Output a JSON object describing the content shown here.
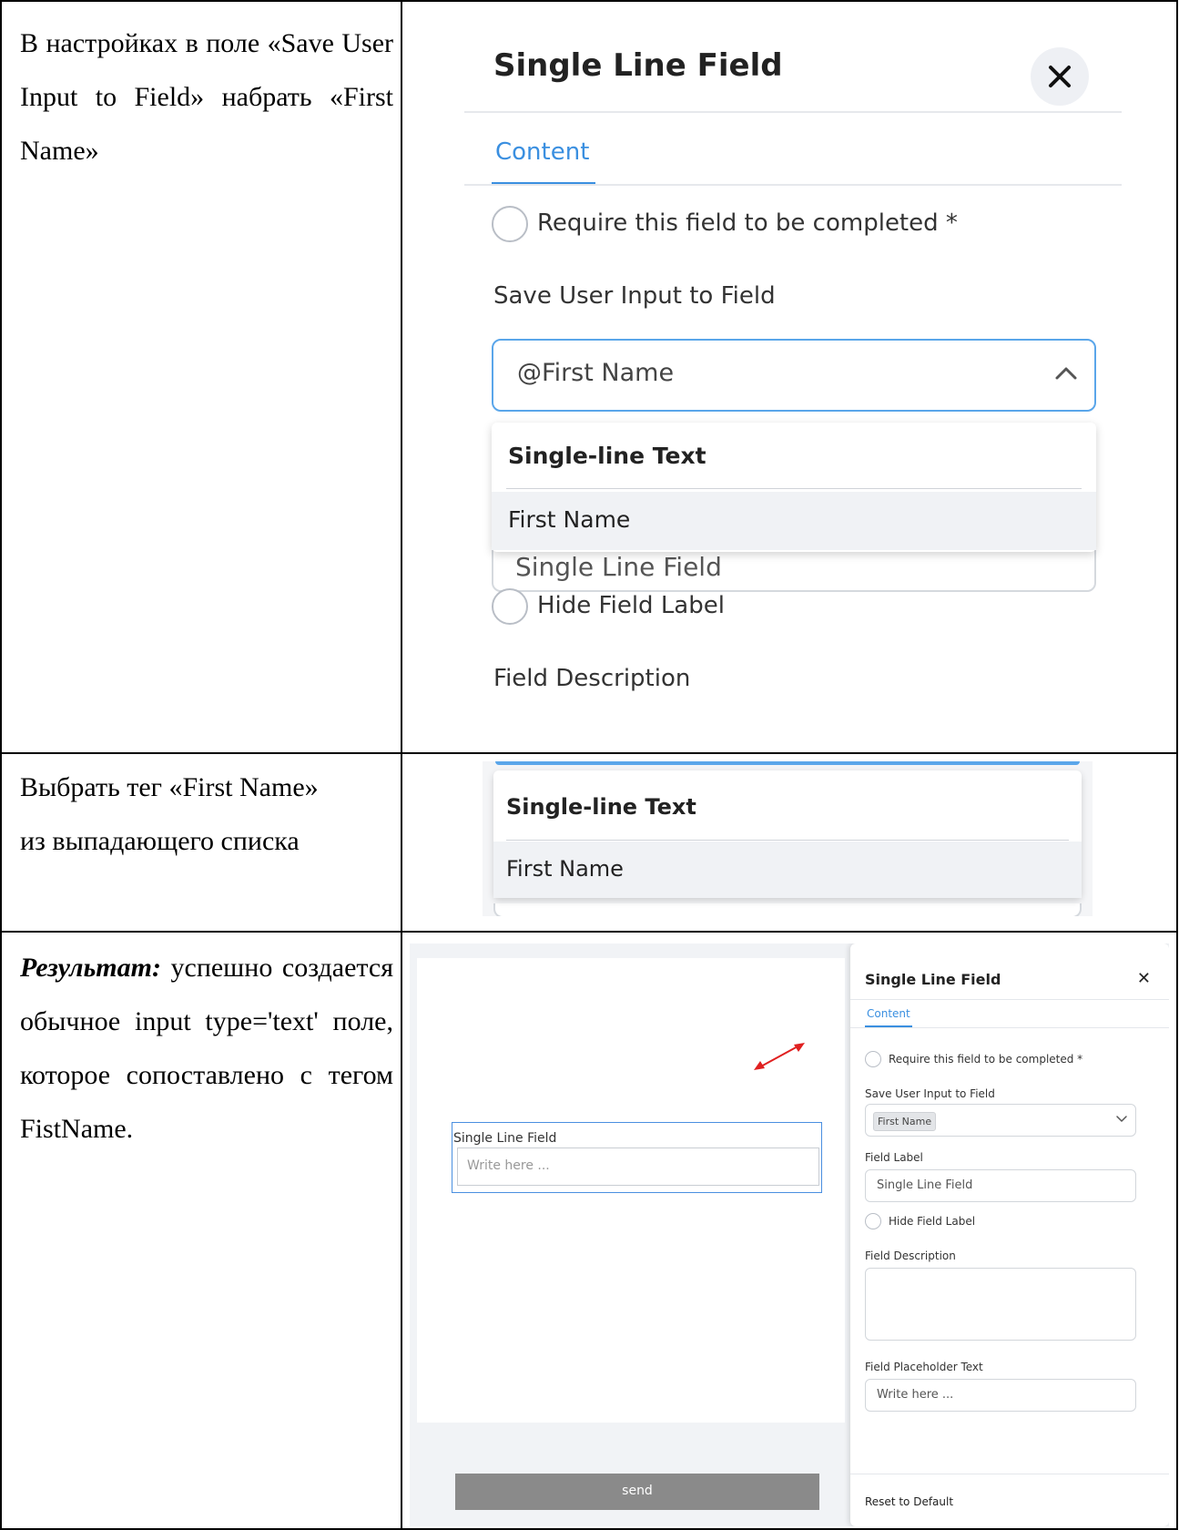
{
  "steps": [
    {
      "instruction": "В настройках в поле «Save User Input to Field» набрать «First Name»",
      "screenshot": {
        "panel_title": "Single Line Field",
        "tab": "Content",
        "require_label": "Require this field to be completed *",
        "save_label": "Save User Input to Field",
        "save_value": "@First Name",
        "dropdown_header": "Single-line Text",
        "dropdown_item": "First Name",
        "field_label_value": "Single Line Field",
        "hide_label": "Hide Field Label",
        "description_label": "Field Description"
      }
    },
    {
      "instruction_line1": "Выбрать тег «First Name»",
      "instruction_line2": "из выпадающего списка",
      "screenshot": {
        "dropdown_header": "Single-line Text",
        "dropdown_item": "First Name"
      }
    },
    {
      "result_label": "Результат:",
      "result_text": "успешно создается обычное input type='text' поле, которое сопоставлено с тегом FistName.",
      "form": {
        "field_label": "Single Line Field",
        "input_placeholder": "Write here ...",
        "send_label": "send"
      },
      "settings": {
        "title": "Single Line Field",
        "close_glyph": "✕",
        "tab": "Content",
        "require_label": "Require this field to be completed *",
        "save_label": "Save User Input to Field",
        "save_tag": "First Name",
        "field_label_label": "Field Label",
        "field_label_value": "Single Line Field",
        "hide_label": "Hide Field Label",
        "description_label": "Field Description",
        "placeholder_label": "Field Placeholder Text",
        "placeholder_value": "Write here ...",
        "reset_label": "Reset to Default"
      }
    }
  ],
  "colors": {
    "accent": "#3a8fe0",
    "arrow": "#e02020",
    "send_button": "#8a8a8a"
  }
}
